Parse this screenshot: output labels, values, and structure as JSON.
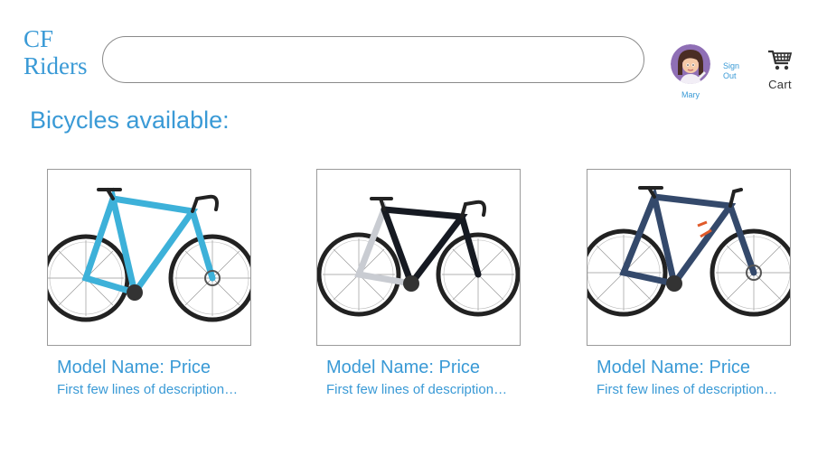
{
  "header": {
    "logo_line1": "CF",
    "logo_line2": "Riders",
    "search_value": "",
    "user_name": "Mary",
    "sign_out_label": "Sign Out",
    "cart_label": "Cart",
    "cart_icon": "shopping-cart-icon",
    "avatar_icon": "user-avatar"
  },
  "page_title": "Bicycles available:",
  "products": [
    {
      "title": "Model Name: Price",
      "description": "First few lines of description…",
      "frame_color": "#3db1d9"
    },
    {
      "title": "Model Name: Price",
      "description": "First few lines of description…",
      "frame_color": "#161a22"
    },
    {
      "title": "Model Name: Price",
      "description": "First few lines of description…",
      "frame_color": "#34496b"
    }
  ],
  "colors": {
    "accent": "#3a9ad6",
    "border": "#8a8a8a"
  }
}
